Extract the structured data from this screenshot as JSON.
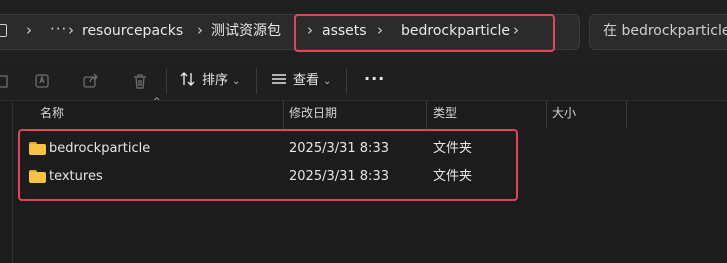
{
  "address_bar": {
    "overflow": "···",
    "crumbs": [
      "resourcepacks",
      "测试资源包",
      "assets",
      "bedrockparticle"
    ],
    "separator": "›"
  },
  "search": {
    "placeholder": "在 bedrockparticle 中"
  },
  "toolbar": {
    "sort_label": "排序",
    "view_label": "查看",
    "more": "···",
    "icons": [
      "new-icon",
      "cut-icon",
      "rename-icon",
      "share-icon",
      "delete-icon",
      "sort-icon",
      "view-icon"
    ]
  },
  "columns": [
    "名称",
    "修改日期",
    "类型",
    "大小"
  ],
  "files": [
    {
      "name": "bedrockparticle",
      "modified": "2025/3/31 8:33",
      "type": "文件夹",
      "size": ""
    },
    {
      "name": "textures",
      "modified": "2025/3/31 8:33",
      "type": "文件夹",
      "size": ""
    }
  ],
  "colors": {
    "highlight": "#e0455a",
    "folder": "#f6c343",
    "background": "#1c1c1c"
  }
}
